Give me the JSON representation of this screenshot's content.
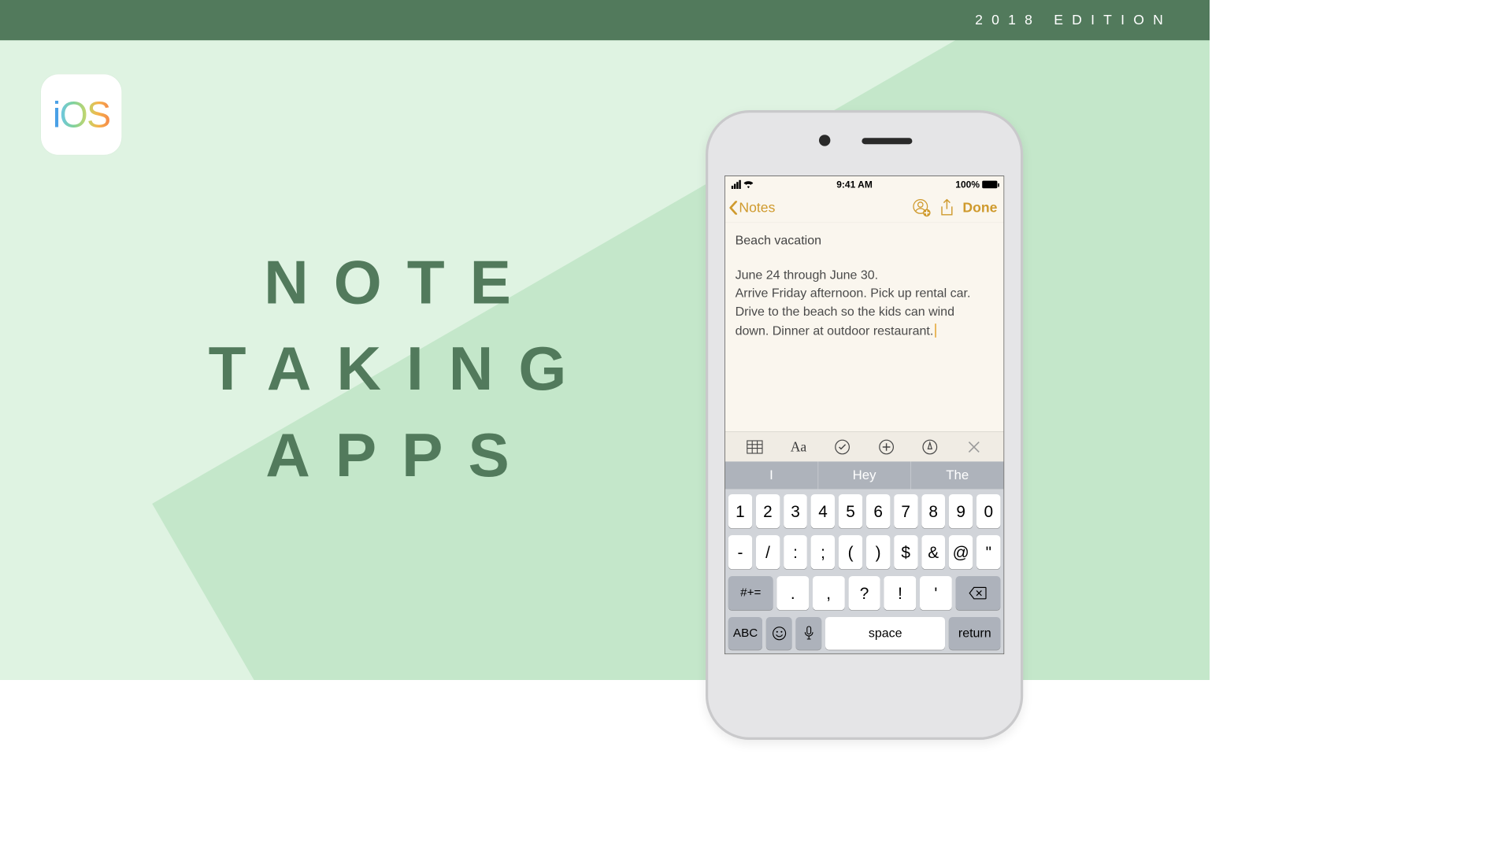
{
  "banner": {
    "edition": "2018 EDITION"
  },
  "ios_badge": {
    "i": "i",
    "o": "O",
    "s": "S"
  },
  "headline": {
    "l1": "NOTE",
    "l2": "TAKING",
    "l3": "APPS"
  },
  "phone": {
    "status": {
      "time": "9:41 AM",
      "battery_pct": "100%"
    },
    "nav": {
      "back": "Notes",
      "done": "Done"
    },
    "note": {
      "title": "Beach vacation",
      "body_l1": "June 24 through June 30.",
      "body_l2": "Arrive Friday afternoon. Pick up rental car.",
      "body_l3": "Drive to the beach so the kids can wind",
      "body_l4": "down. Dinner at outdoor restaurant."
    },
    "toolbar": {
      "text_style": "Aa"
    },
    "suggestions": [
      "I",
      "Hey",
      "The"
    ],
    "keyboard": {
      "row1": [
        "1",
        "2",
        "3",
        "4",
        "5",
        "6",
        "7",
        "8",
        "9",
        "0"
      ],
      "row2": [
        "-",
        "/",
        ":",
        ";",
        "(",
        ")",
        "$",
        "&",
        "@",
        "\""
      ],
      "row3_shift": "#+=",
      "row3": [
        ".",
        ",",
        "?",
        "!",
        "'"
      ],
      "row4_abc": "ABC",
      "row4_space": "space",
      "row4_return": "return"
    }
  }
}
